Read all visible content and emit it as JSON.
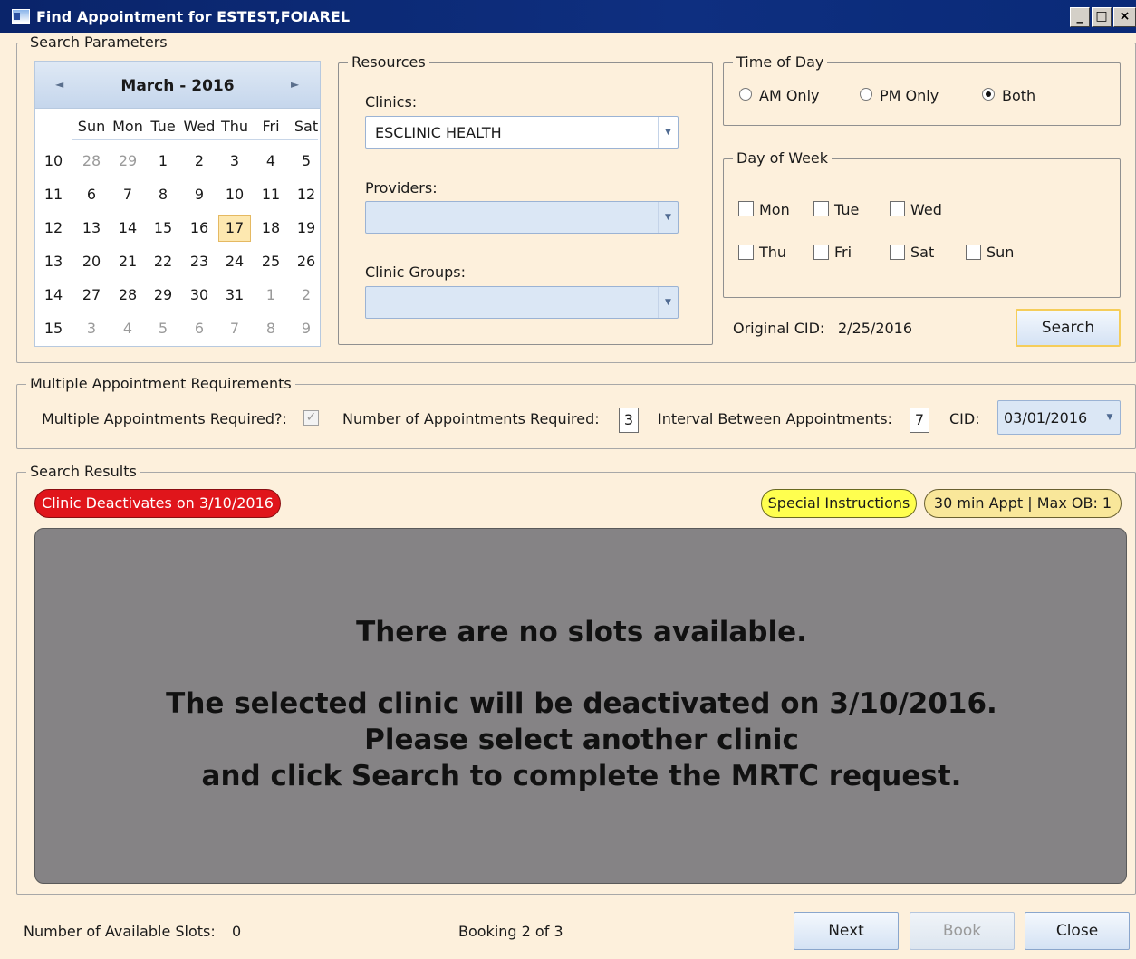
{
  "window": {
    "title": "Find Appointment for ESTEST,FOIAREL",
    "min_symbol": "_",
    "max_symbol": "□",
    "close_symbol": "×"
  },
  "search_params": {
    "legend": "Search Parameters",
    "calendar": {
      "month_label": "March - 2016",
      "prev_symbol": "◄",
      "next_symbol": "►",
      "day_names": [
        "Sun",
        "Mon",
        "Tue",
        "Wed",
        "Thu",
        "Fri",
        "Sat"
      ],
      "weeks": [
        {
          "num": "10",
          "days": [
            "28",
            "29",
            "1",
            "2",
            "3",
            "4",
            "5"
          ]
        },
        {
          "num": "11",
          "days": [
            "6",
            "7",
            "8",
            "9",
            "10",
            "11",
            "12"
          ]
        },
        {
          "num": "12",
          "days": [
            "13",
            "14",
            "15",
            "16",
            "17",
            "18",
            "19"
          ]
        },
        {
          "num": "13",
          "days": [
            "20",
            "21",
            "22",
            "23",
            "24",
            "25",
            "26"
          ]
        },
        {
          "num": "14",
          "days": [
            "27",
            "28",
            "29",
            "30",
            "31",
            "1",
            "2"
          ]
        },
        {
          "num": "15",
          "days": [
            "3",
            "4",
            "5",
            "6",
            "7",
            "8",
            "9"
          ]
        }
      ],
      "selected_day": "17"
    },
    "resources": {
      "legend": "Resources",
      "clinics_label": "Clinics:",
      "clinics_value": "ESCLINIC HEALTH",
      "providers_label": "Providers:",
      "providers_value": "",
      "clinic_groups_label": "Clinic Groups:",
      "clinic_groups_value": ""
    },
    "time_of_day": {
      "legend": "Time of Day",
      "options": [
        "AM Only",
        "PM Only",
        "Both"
      ],
      "selected": "Both"
    },
    "day_of_week": {
      "legend": "Day of Week",
      "days": [
        "Mon",
        "Tue",
        "Wed",
        "Thu",
        "Fri",
        "Sat",
        "Sun"
      ]
    },
    "original_cid_label": "Original CID:",
    "original_cid_value": "2/25/2016",
    "search_button": "Search"
  },
  "multi": {
    "legend": "Multiple Appointment Requirements",
    "required_label": "Multiple Appointments Required?:",
    "required_checked": true,
    "count_label": "Number of Appointments Required:",
    "count_value": "3",
    "interval_label": "Interval Between Appointments:",
    "interval_value": "7",
    "cid_label": "CID:",
    "cid_value": "03/01/2016"
  },
  "results": {
    "legend": "Search Results",
    "deactivate_badge": "Clinic Deactivates on 3/10/2016",
    "special_instructions": "Special Instructions",
    "appt_info": "30 min Appt | Max OB: 1",
    "message_line1": "There are no slots available.",
    "message_line2": "The selected clinic will be deactivated on 3/10/2016.",
    "message_line3": "Please select another clinic",
    "message_line4": "and click Search to complete the MRTC request."
  },
  "footer": {
    "slots_label": "Number of Available Slots:",
    "slots_value": "0",
    "booking_status": "Booking 2 of 3",
    "next_button": "Next",
    "book_button": "Book",
    "close_button": "Close"
  },
  "colors": {
    "titlebar": "#0a246a",
    "background": "#fdf0dc",
    "deactivate_badge": "#e0151b",
    "special_instructions": "#ffff4f",
    "appt_info": "#f9e79a",
    "results_pane": "#858385"
  }
}
